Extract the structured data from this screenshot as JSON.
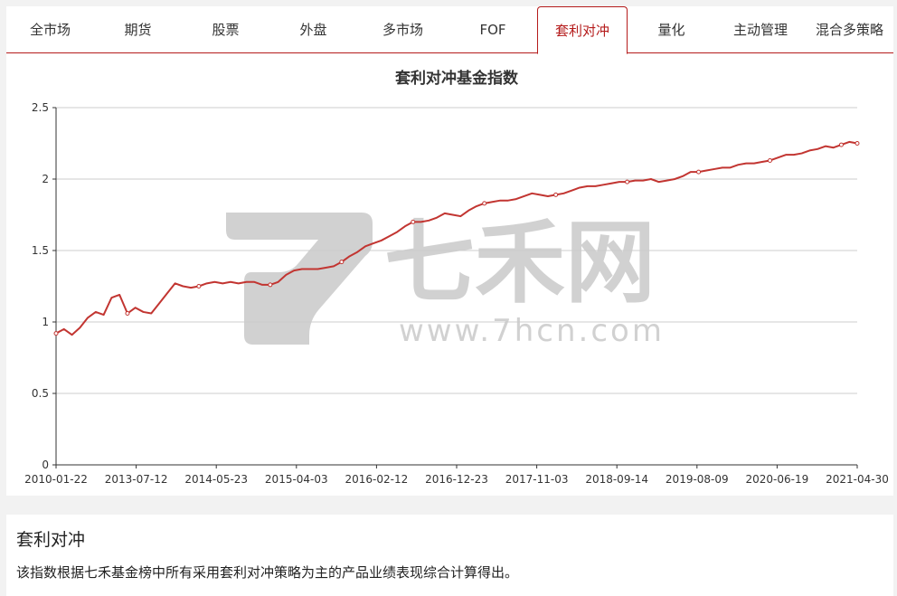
{
  "tabs": [
    {
      "label": "全市场",
      "active": false
    },
    {
      "label": "期货",
      "active": false
    },
    {
      "label": "股票",
      "active": false
    },
    {
      "label": "外盘",
      "active": false
    },
    {
      "label": "多市场",
      "active": false
    },
    {
      "label": "FOF",
      "active": false
    },
    {
      "label": "套利对冲",
      "active": true
    },
    {
      "label": "量化",
      "active": false
    },
    {
      "label": "主动管理",
      "active": false
    },
    {
      "label": "混合多策略",
      "active": false
    }
  ],
  "watermark": {
    "brand": "七禾网",
    "url": "www.7hcn.com"
  },
  "colors": {
    "accent": "#b51c1c",
    "line": "#c23531",
    "grid": "#cccccc"
  },
  "chart_data": {
    "type": "line",
    "title": "套利对冲基金指数",
    "ylim": [
      0,
      2.5
    ],
    "yticks": [
      "0",
      "0.5",
      "1",
      "1.5",
      "2",
      "2.5"
    ],
    "xticks": [
      "2010-01-22",
      "2013-07-12",
      "2014-05-23",
      "2015-04-03",
      "2016-02-12",
      "2016-12-23",
      "2017-11-03",
      "2018-09-14",
      "2019-08-09",
      "2020-06-19",
      "2021-04-30"
    ],
    "grid": true,
    "legend": "none",
    "series": [
      {
        "values": [
          0.92,
          0.95,
          0.91,
          0.96,
          1.03,
          1.07,
          1.05,
          1.17,
          1.19,
          1.06,
          1.1,
          1.07,
          1.06,
          1.13,
          1.2,
          1.27,
          1.25,
          1.24,
          1.25,
          1.27,
          1.28,
          1.27,
          1.28,
          1.27,
          1.28,
          1.28,
          1.26,
          1.26,
          1.28,
          1.33,
          1.36,
          1.37,
          1.37,
          1.37,
          1.38,
          1.39,
          1.42,
          1.46,
          1.49,
          1.53,
          1.55,
          1.57,
          1.6,
          1.63,
          1.67,
          1.7,
          1.7,
          1.71,
          1.73,
          1.76,
          1.75,
          1.74,
          1.78,
          1.81,
          1.83,
          1.84,
          1.85,
          1.85,
          1.86,
          1.88,
          1.9,
          1.89,
          1.88,
          1.89,
          1.9,
          1.92,
          1.94,
          1.95,
          1.95,
          1.96,
          1.97,
          1.98,
          1.98,
          1.99,
          1.99,
          2.0,
          1.98,
          1.99,
          2.0,
          2.02,
          2.05,
          2.05,
          2.06,
          2.07,
          2.08,
          2.08,
          2.1,
          2.11,
          2.11,
          2.12,
          2.13,
          2.15,
          2.17,
          2.17,
          2.18,
          2.2,
          2.21,
          2.23,
          2.22,
          2.24,
          2.26,
          2.25
        ]
      }
    ]
  },
  "info": {
    "title": "套利对冲",
    "description": "该指数根据七禾基金榜中所有采用套利对冲策略为主的产品业绩表现综合计算得出。"
  }
}
